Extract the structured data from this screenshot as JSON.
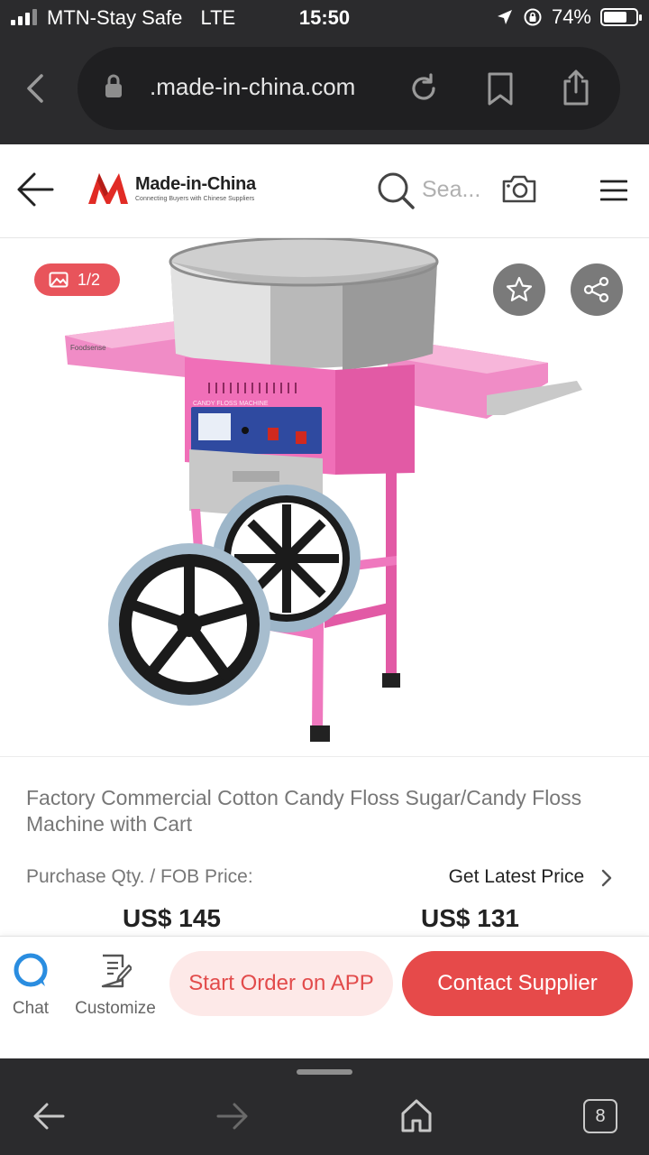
{
  "status_bar": {
    "carrier": "MTN-Stay Safe",
    "network": "LTE",
    "time": "15:50",
    "battery": "74%",
    "battery_level": 0.74
  },
  "browser": {
    "url": ".made-in-china.com"
  },
  "header": {
    "logo_name": "Made-in-China",
    "logo_tagline": "Connecting Buyers with Chinese Suppliers",
    "search_placeholder": "Sea..."
  },
  "gallery": {
    "photo_counter": "1/2",
    "machine_label": "CANDY FLOSS MACHINE",
    "brand_label": "Foodsense"
  },
  "product": {
    "title": "Factory Commercial Cotton Candy Floss Sugar/Candy Floss Machine with Cart",
    "qty_label": "Purchase Qty. / FOB Price:",
    "latest_price_link": "Get Latest Price",
    "prices": [
      "US$ 145",
      "US$ 131"
    ]
  },
  "actions": {
    "chat": "Chat",
    "customize": "Customize",
    "start_order": "Start Order on APP",
    "contact_supplier": "Contact Supplier"
  },
  "bottom_toolbar": {
    "tab_count": "8"
  },
  "colors": {
    "accent_red": "#e64a4a",
    "pink_machine": "#f06fb8",
    "dark_chrome": "#2b2b2d"
  }
}
